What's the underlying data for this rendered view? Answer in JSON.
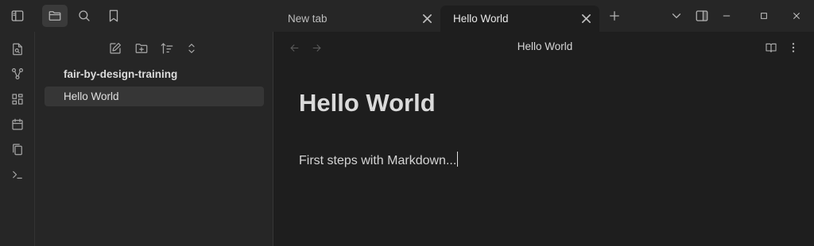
{
  "titlebar": {
    "icons": [
      "sidebar-toggle-icon",
      "folder-icon",
      "search-icon",
      "bookmark-icon"
    ],
    "tabs": [
      {
        "label": "New tab",
        "active": false
      },
      {
        "label": "Hello World",
        "active": true
      }
    ],
    "new_tab_icon": "plus-icon",
    "window_controls": [
      "minimize-icon",
      "maximize-icon",
      "close-icon"
    ]
  },
  "ribbon": {
    "icons": [
      "open-quick-switcher-icon",
      "graph-view-icon",
      "canvas-icon",
      "daily-note-icon",
      "templates-icon",
      "command-palette-icon"
    ]
  },
  "sidebar": {
    "tools": [
      "new-note-icon",
      "new-folder-icon",
      "sort-icon",
      "collapse-icon"
    ],
    "vault_name": "fair-by-design-training",
    "files": [
      "Hello World"
    ]
  },
  "main": {
    "view_title": "Hello World",
    "heading": "Hello World",
    "paragraph": "First steps with Markdown..."
  },
  "colors": {
    "background": "#1e1e1e",
    "panel": "#262626",
    "active_item": "#363636",
    "text": "#dadada"
  }
}
